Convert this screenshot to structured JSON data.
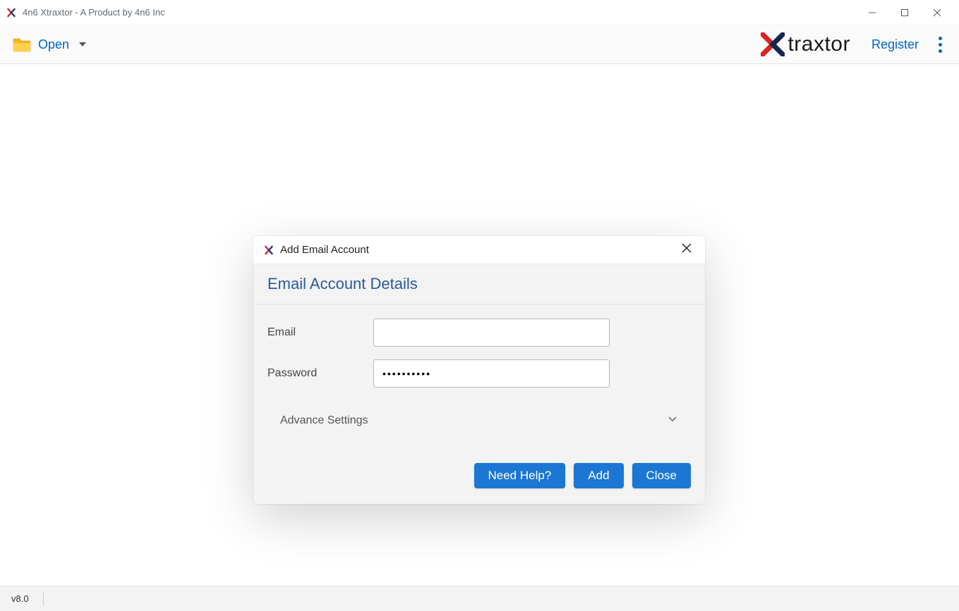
{
  "window": {
    "title": "4n6 Xtraxtor - A Product by 4n6 Inc"
  },
  "toolbar": {
    "open_label": "Open",
    "brand_text": "traxtor",
    "register_label": "Register"
  },
  "dialog": {
    "title": "Add Email Account",
    "subtitle": "Email Account Details",
    "email_label": "Email",
    "email_value": "",
    "password_label": "Password",
    "password_value": "••••••••••",
    "advance_label": "Advance Settings",
    "buttons": {
      "help": "Need Help?",
      "add": "Add",
      "close": "Close"
    }
  },
  "statusbar": {
    "version": "v8.0"
  }
}
